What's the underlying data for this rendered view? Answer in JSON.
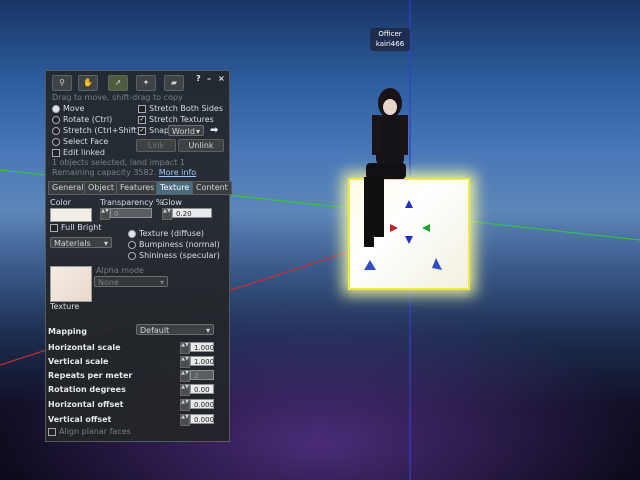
{
  "nametag": {
    "line1": "Officer",
    "line2": "kairi466"
  },
  "hint": "Drag to move, shift-drag to copy",
  "toolbar": {
    "focus": "focus-icon",
    "move": "hand-icon",
    "edit": "pointer-icon",
    "create": "wand-icon",
    "land": "bulldozer-icon",
    "help": "?",
    "minimize": "–",
    "close": "×"
  },
  "modes": {
    "move": "Move",
    "rotate": "Rotate (Ctrl)",
    "stretch": "Stretch (Ctrl+Shift)",
    "select_face": "Select Face",
    "edit_linked": "Edit linked"
  },
  "options": {
    "stretch_both": "Stretch Both Sides",
    "stretch_textures": "Stretch Textures",
    "snap": "Snap",
    "snap_mode": "World"
  },
  "buttons": {
    "link": "Link",
    "unlink": "Unlink"
  },
  "status": {
    "line1": "1 objects selected, land impact 1",
    "line2_prefix": "Remaining capacity 3582.",
    "more_info": "More info"
  },
  "tabs": [
    "General",
    "Object",
    "Features",
    "Texture",
    "Content"
  ],
  "texture": {
    "color_label": "Color",
    "transparency_label": "Transparency %",
    "transparency_value": "0",
    "glow_label": "Glow",
    "glow_value": "0.20",
    "full_bright": "Full Bright",
    "materials": "Materials",
    "radio_diffuse": "Texture (diffuse)",
    "radio_bump": "Bumpiness (normal)",
    "radio_shiny": "Shininess (specular)",
    "alpha_mode_label": "Alpha mode",
    "alpha_mode_value": "None",
    "texture_label": "Texture",
    "mapping_label": "Mapping",
    "mapping_value": "Default",
    "h_scale_label": "Horizontal scale",
    "h_scale_value": "1.000",
    "v_scale_label": "Vertical scale",
    "v_scale_value": "1.000",
    "repeats_label": "Repeats per meter",
    "repeats_value": "2",
    "rotation_label": "Rotation degrees",
    "rotation_value": "0.00",
    "h_offset_label": "Horizontal offset",
    "h_offset_value": "0.000",
    "v_offset_label": "Vertical offset",
    "v_offset_value": "0.000",
    "align_planar": "Align planar faces"
  },
  "colors": {
    "accent_tab": "#4a6b82",
    "cube_glow": "#f0e84a",
    "panel_bg": "#232628"
  }
}
